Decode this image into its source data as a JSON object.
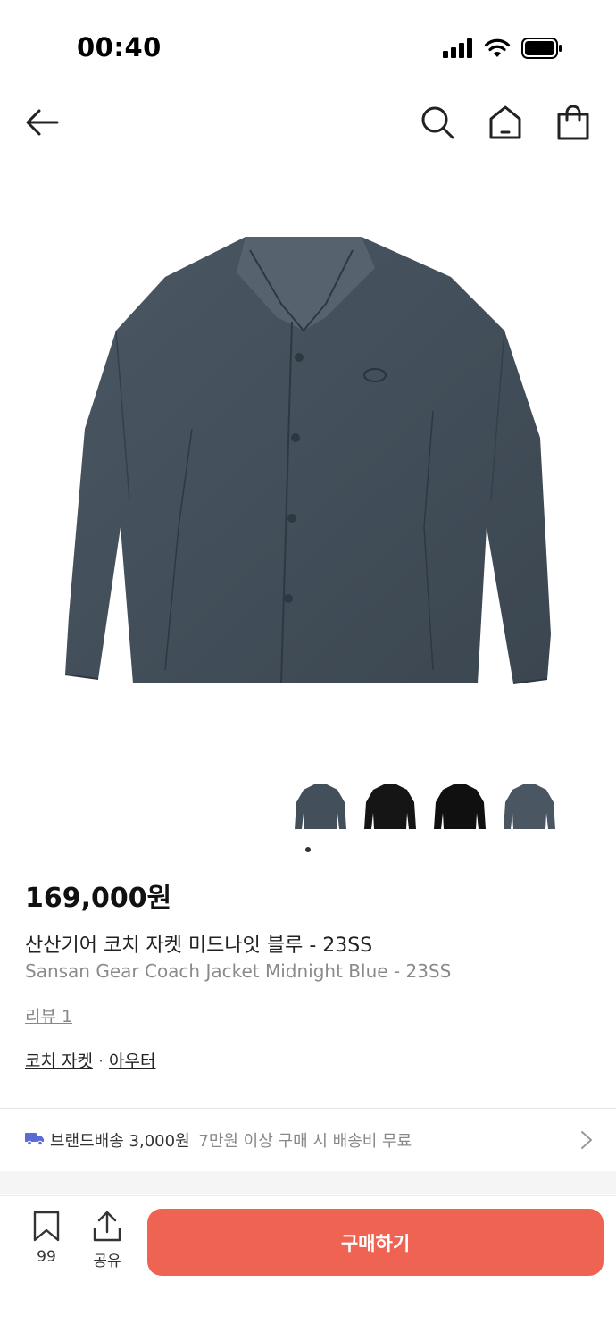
{
  "status": {
    "time": "00:40"
  },
  "product": {
    "price": "169,000원",
    "name_ko": "산산기어 코치 자켓 미드나잇 블루 - 23SS",
    "name_en": "Sansan Gear Coach Jacket Midnight Blue - 23SS",
    "review": "리뷰 1",
    "categories": [
      "코치 자켓",
      "아우터"
    ],
    "category_separator": "·"
  },
  "shipping": {
    "brand": "브랜드배송",
    "fee": "3,000원",
    "note": "7만원 이상 구매 시 배송비 무료"
  },
  "bottom": {
    "favorites": "99",
    "share": "공유",
    "buy": "구매하기"
  },
  "colors": {
    "accent": "#ee6352",
    "jacket_blue": "#434f5a",
    "truck": "#5b6bd6"
  },
  "thumbnails": [
    "midnight-blue",
    "black",
    "black",
    "midnight-blue"
  ]
}
